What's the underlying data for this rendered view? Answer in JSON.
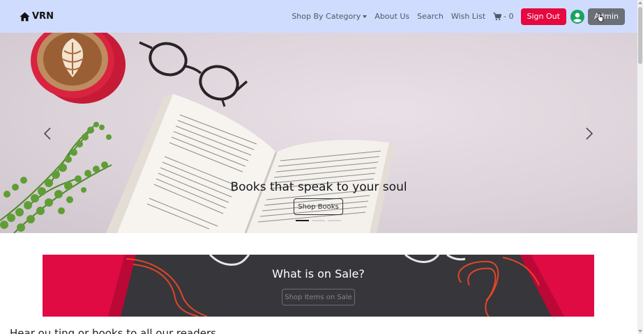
{
  "navbar": {
    "brand": "VRN",
    "links": {
      "shop_by_category": "Shop By Category",
      "about_us": "About Us",
      "search": "Search",
      "wish_list": "Wish List",
      "cart_count": "- 0"
    },
    "sign_out": "Sign Out",
    "admin": "Admin"
  },
  "hero": {
    "caption": "Books that speak to your soul",
    "button": "Shop Books",
    "slide_count": 3,
    "active_slide": 1
  },
  "sale": {
    "title": "What is on Sale?",
    "button": "Shop Items on Sale"
  },
  "next_section": {
    "heading": "Hear ou ting or books to all our readers"
  },
  "colors": {
    "navbar_bg": "#d0dcfd",
    "sign_out_bg": "#e5093f",
    "admin_bg": "#6b7078",
    "avatar": "#1aa260"
  },
  "icons": [
    "home-icon",
    "caret-down-icon",
    "cart-icon",
    "user-circle-icon",
    "chevron-left-icon",
    "chevron-right-icon",
    "mouse-cursor-icon"
  ]
}
